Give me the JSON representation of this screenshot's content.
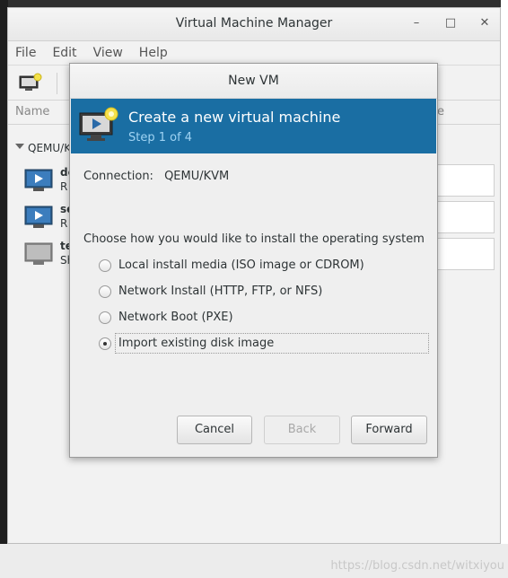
{
  "app": {
    "title": "Virtual Machine Manager",
    "menu": [
      "File",
      "Edit",
      "View",
      "Help"
    ],
    "list_header": {
      "name": "Name",
      "cpu": "e"
    },
    "group": "QEMU/K",
    "vms": [
      {
        "name": "de",
        "state": "R"
      },
      {
        "name": "se",
        "state": "R"
      },
      {
        "name": "te",
        "state": "Sh"
      }
    ]
  },
  "dialog": {
    "title": "New VM",
    "banner_title": "Create a new virtual machine",
    "step": "Step 1 of 4",
    "connection_label": "Connection:",
    "connection_value": "QEMU/KVM",
    "question": "Choose how you would like to install the operating system",
    "options": [
      {
        "label": "Local install media (ISO image or CDROM)",
        "checked": false
      },
      {
        "label": "Network Install (HTTP, FTP, or NFS)",
        "checked": false
      },
      {
        "label": "Network Boot (PXE)",
        "checked": false
      },
      {
        "label": "Import existing disk image",
        "checked": true
      }
    ],
    "buttons": {
      "cancel": "Cancel",
      "back": "Back",
      "forward": "Forward"
    }
  },
  "watermark": "https://blog.csdn.net/witxiyou",
  "colors": {
    "banner": "#1a6ea3",
    "step_text": "#9fd3f3"
  }
}
